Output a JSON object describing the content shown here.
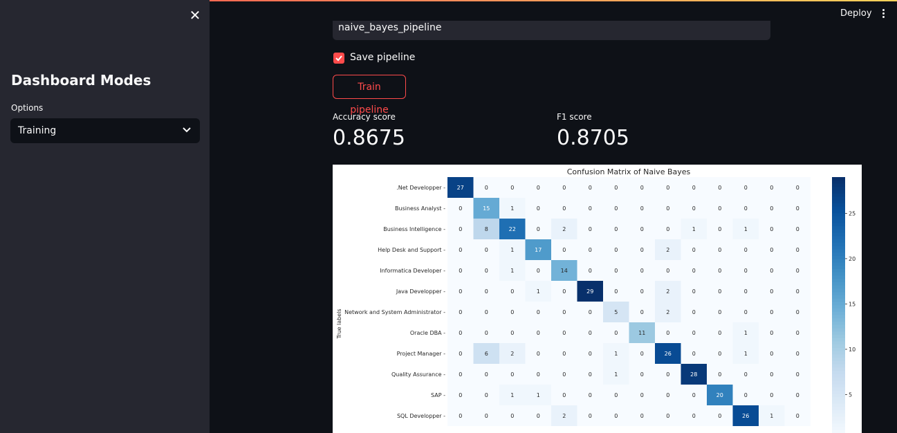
{
  "sidebar": {
    "title": "Dashboard Modes",
    "options_label": "Options",
    "selected_mode": "Training"
  },
  "header": {
    "deploy_label": "Deploy"
  },
  "main": {
    "pipeline_name_value": "naive_bayes_pipeline",
    "save_pipeline_label": "Save pipeline",
    "save_pipeline_checked": true,
    "train_button_label": "Train pipeline",
    "metrics": [
      {
        "label": "Accuracy score",
        "value": "0.8675"
      },
      {
        "label": "F1 score",
        "value": "0.8705"
      }
    ]
  },
  "colors": {
    "accent": "#ff4b4b",
    "background": "#0e1117",
    "sidebar": "#262730"
  },
  "chart_data": {
    "type": "heatmap",
    "title": "Confusion Matrix of Naive Bayes",
    "ylabel": "True labels",
    "row_labels": [
      ".Net Developper",
      "Business Analyst",
      "Business Intelligence",
      "Help Desk and Support",
      "Informatica Developer",
      "Java Developper",
      "Network and System Administrator",
      "Oracle DBA",
      "Project Manager",
      "Quality Assurance",
      "SAP",
      "SQL Developper"
    ],
    "matrix": [
      [
        27,
        0,
        0,
        0,
        0,
        0,
        0,
        0,
        0,
        0,
        0,
        0,
        0,
        0
      ],
      [
        0,
        15,
        1,
        0,
        0,
        0,
        0,
        0,
        0,
        0,
        0,
        0,
        0,
        0
      ],
      [
        0,
        8,
        22,
        0,
        2,
        0,
        0,
        0,
        0,
        1,
        0,
        1,
        0,
        0
      ],
      [
        0,
        0,
        1,
        17,
        0,
        0,
        0,
        0,
        2,
        0,
        0,
        0,
        0,
        0
      ],
      [
        0,
        0,
        1,
        0,
        14,
        0,
        0,
        0,
        0,
        0,
        0,
        0,
        0,
        0
      ],
      [
        0,
        0,
        0,
        1,
        0,
        29,
        0,
        0,
        2,
        0,
        0,
        0,
        0,
        0
      ],
      [
        0,
        0,
        0,
        0,
        0,
        0,
        5,
        0,
        2,
        0,
        0,
        0,
        0,
        0
      ],
      [
        0,
        0,
        0,
        0,
        0,
        0,
        0,
        11,
        0,
        0,
        0,
        1,
        0,
        0
      ],
      [
        0,
        6,
        2,
        0,
        0,
        0,
        1,
        0,
        26,
        0,
        0,
        1,
        0,
        0
      ],
      [
        0,
        0,
        0,
        0,
        0,
        0,
        1,
        0,
        0,
        28,
        0,
        0,
        0,
        0
      ],
      [
        0,
        0,
        1,
        1,
        0,
        0,
        0,
        0,
        0,
        0,
        20,
        0,
        0,
        0
      ],
      [
        0,
        0,
        0,
        0,
        2,
        0,
        0,
        0,
        0,
        0,
        0,
        26,
        1,
        0
      ]
    ],
    "colorbar_ticks": [
      5,
      10,
      15,
      20,
      25
    ],
    "colorbar_range": [
      0,
      29
    ],
    "colormap": "Blues"
  }
}
